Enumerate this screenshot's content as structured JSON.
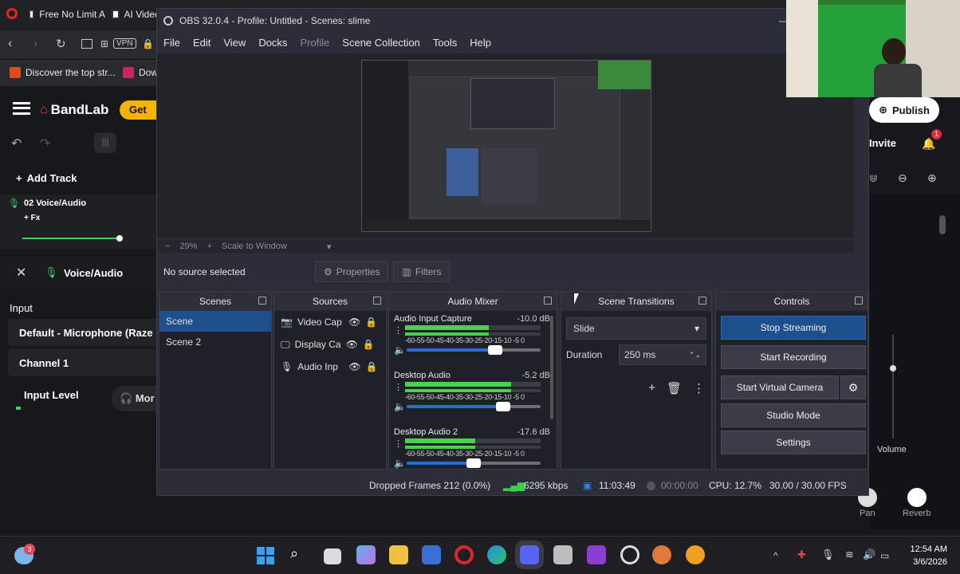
{
  "browser": {
    "tabs": [
      {
        "label": "Free No Limit A"
      },
      {
        "label": "AI Videc"
      }
    ],
    "nav": {
      "vpn_label": "VPN"
    },
    "bookmarks": [
      {
        "label": "Discover the top str..."
      },
      {
        "label": "Dow"
      }
    ]
  },
  "bandlab": {
    "logo_text": "BandLab",
    "get_label": "Get",
    "publish_label": "Publish",
    "invite_label": "Invite",
    "notification_count": "1",
    "add_track_label": "Add Track",
    "track_name": "02 Voice/Audio",
    "fx_label": "+ Fx",
    "panel_title": "Voice/Audio",
    "input_label": "Input",
    "input_device": "Default - Microphone (Raze",
    "channel": "Channel 1",
    "input_level_label": "Input Level",
    "monitor_label": "Mor",
    "volume_label": "Volume",
    "pan_label": "Pan",
    "reverb_label": "Reverb"
  },
  "obs": {
    "title": "OBS 32.0.4 - Profile: Untitled - Scenes: slime",
    "menu": [
      {
        "label": "File",
        "disabled": false
      },
      {
        "label": "Edit",
        "disabled": false
      },
      {
        "label": "View",
        "disabled": false
      },
      {
        "label": "Docks",
        "disabled": false
      },
      {
        "label": "Profile",
        "disabled": true
      },
      {
        "label": "Scene Collection",
        "disabled": false
      },
      {
        "label": "Tools",
        "disabled": false
      },
      {
        "label": "Help",
        "disabled": false
      }
    ],
    "zoom": {
      "minus": "−",
      "value": "29%",
      "plus": "+",
      "mode": "Scale to Window"
    },
    "context": {
      "no_source": "No source selected",
      "properties": "Properties",
      "filters": "Filters"
    },
    "docks": {
      "scenes": {
        "title": "Scenes",
        "items": [
          {
            "label": "Scene",
            "selected": true
          },
          {
            "label": "Scene 2",
            "selected": false
          }
        ]
      },
      "sources": {
        "title": "Sources",
        "items": [
          {
            "label": "Video Cap",
            "icon": "camera-icon"
          },
          {
            "label": "Display Ca",
            "icon": "monitor-icon"
          },
          {
            "label": "Audio Inp",
            "icon": "microphone-icon"
          }
        ]
      },
      "mixer": {
        "title": "Audio Mixer",
        "channels": [
          {
            "name": "Audio Input Capture",
            "db": "-10.0 dB",
            "level": 0.62,
            "volume": 0.66
          },
          {
            "name": "Desktop Audio",
            "db": "-5.2 dB",
            "level": 0.78,
            "volume": 0.72
          },
          {
            "name": "Desktop Audio 2",
            "db": "-17.6 dB",
            "level": 0.52,
            "volume": 0.5
          }
        ],
        "ticks": "-60-55-50-45-40-35-30-25-20-15-10 -5 0"
      },
      "transitions": {
        "title": "Scene Transitions",
        "type": "Slide",
        "duration_label": "Duration",
        "duration_value": "250 ms"
      },
      "controls": {
        "title": "Controls",
        "stop_streaming": "Stop Streaming",
        "start_recording": "Start Recording",
        "start_virtual_camera": "Start Virtual Camera",
        "studio_mode": "Studio Mode",
        "settings": "Settings"
      }
    },
    "status": {
      "dropped": "Dropped Frames 212 (0.0%)",
      "bitrate": "6295 kbps",
      "stream_time": "11:03:49",
      "rec_time": "00:00:00",
      "cpu": "CPU: 12.7%",
      "fps": "30.00 / 30.00 FPS"
    }
  },
  "taskbar": {
    "time": "12:54 AM",
    "date": "3/6/2026",
    "badge": "3"
  },
  "colors": {
    "obs_bg": "#2b2e38",
    "selection": "#1d4f8c",
    "stream_button": "#1d4f8c",
    "bandlab_accent": "#f5b400",
    "webcam_green": "#2c7a2c"
  }
}
